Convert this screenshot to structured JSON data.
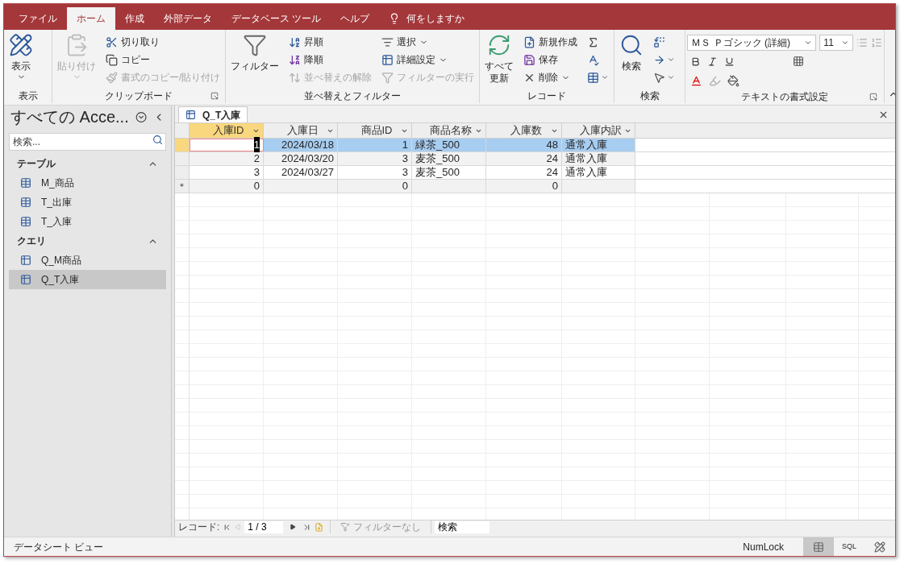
{
  "tabs": [
    {
      "label": "ファイル",
      "selected": false
    },
    {
      "label": "ホーム",
      "selected": true
    },
    {
      "label": "作成",
      "selected": false
    },
    {
      "label": "外部データ",
      "selected": false
    },
    {
      "label": "データベース ツール",
      "selected": false
    },
    {
      "label": "ヘルプ",
      "selected": false
    }
  ],
  "tell_me": {
    "placeholder": "何をしますか"
  },
  "ribbon": {
    "groups": [
      {
        "title": "表示",
        "items": [
          {
            "label": "表示",
            "disabled": false
          }
        ]
      },
      {
        "title": "クリップボード",
        "items": [
          {
            "label": "貼り付け",
            "disabled": true
          },
          {
            "label": "切り取り",
            "disabled": false
          },
          {
            "label": "コピー",
            "disabled": false
          },
          {
            "label": "書式のコピー/貼り付け",
            "disabled": true
          }
        ]
      },
      {
        "title": "並べ替えとフィルター",
        "items": [
          {
            "label": "フィルター",
            "disabled": false
          },
          {
            "label": "昇順",
            "disabled": false
          },
          {
            "label": "降順",
            "disabled": false
          },
          {
            "label": "並べ替えの解除",
            "disabled": true
          },
          {
            "label": "選択",
            "disabled": false
          },
          {
            "label": "詳細設定",
            "disabled": false
          },
          {
            "label": "フィルターの実行",
            "disabled": true
          }
        ]
      },
      {
        "title": "レコード",
        "items": [
          {
            "label": "すべて",
            "label_2": "更新",
            "disabled": false
          },
          {
            "label": "新規作成",
            "disabled": false
          },
          {
            "label": "保存",
            "disabled": false
          },
          {
            "label": "削除",
            "disabled": false
          }
        ]
      },
      {
        "title": "検索",
        "items": [
          {
            "label": "検索",
            "disabled": false
          }
        ]
      },
      {
        "title": "テキストの書式設定",
        "font": "ＭＳ Ｐゴシック (詳細)",
        "size": "11"
      }
    ]
  },
  "nav_pane": {
    "title": "すべての Acce...",
    "search": {
      "placeholder": "検索..."
    },
    "groups": [
      {
        "title": "テーブル",
        "expanded": true,
        "items": [
          {
            "label": "M_商品",
            "selected": false
          },
          {
            "label": "T_出庫",
            "selected": false
          },
          {
            "label": "T_入庫",
            "selected": false
          }
        ]
      },
      {
        "title": "クエリ",
        "expanded": true,
        "items": [
          {
            "label": "Q_M商品",
            "selected": false
          },
          {
            "label": "Q_T入庫",
            "selected": true
          }
        ]
      }
    ]
  },
  "document_tab": {
    "title": "Q_T入庫"
  },
  "table": {
    "columns": [
      {
        "label": "入庫ID",
        "kind": "number",
        "selected": true
      },
      {
        "label": "入庫日",
        "kind": "number",
        "selected": false
      },
      {
        "label": "商品ID",
        "kind": "number",
        "selected": false
      },
      {
        "label": "商品名称",
        "kind": "text",
        "selected": false
      },
      {
        "label": "入庫数",
        "kind": "number",
        "selected": false
      },
      {
        "label": "入庫内訳",
        "kind": "text",
        "selected": false
      }
    ],
    "rows": [
      {
        "selected": true,
        "cells": [
          "1",
          "2024/03/18",
          "1",
          "緑茶_500",
          "48",
          "通常入庫"
        ]
      },
      {
        "selected": false,
        "cells": [
          "2",
          "2024/03/20",
          "3",
          "麦茶_500",
          "24",
          "通常入庫"
        ]
      },
      {
        "selected": false,
        "cells": [
          "3",
          "2024/03/27",
          "3",
          "麦茶_500",
          "24",
          "通常入庫"
        ]
      }
    ],
    "new_row": {
      "marker": "＊",
      "cells": [
        "0",
        null,
        "0",
        null,
        "0",
        null
      ]
    }
  },
  "record_nav": {
    "label": "レコード:",
    "position": "1 / 3",
    "filter": "フィルターなし",
    "search": {
      "placeholder": "検索"
    }
  },
  "status_bar": {
    "text": "データシート ビュー",
    "numlock": "NumLock",
    "views": [
      {
        "kind": "datasheet",
        "selected": true
      },
      {
        "kind": "sql",
        "label": "SQL",
        "selected": false
      },
      {
        "kind": "design",
        "selected": false
      }
    ]
  }
}
